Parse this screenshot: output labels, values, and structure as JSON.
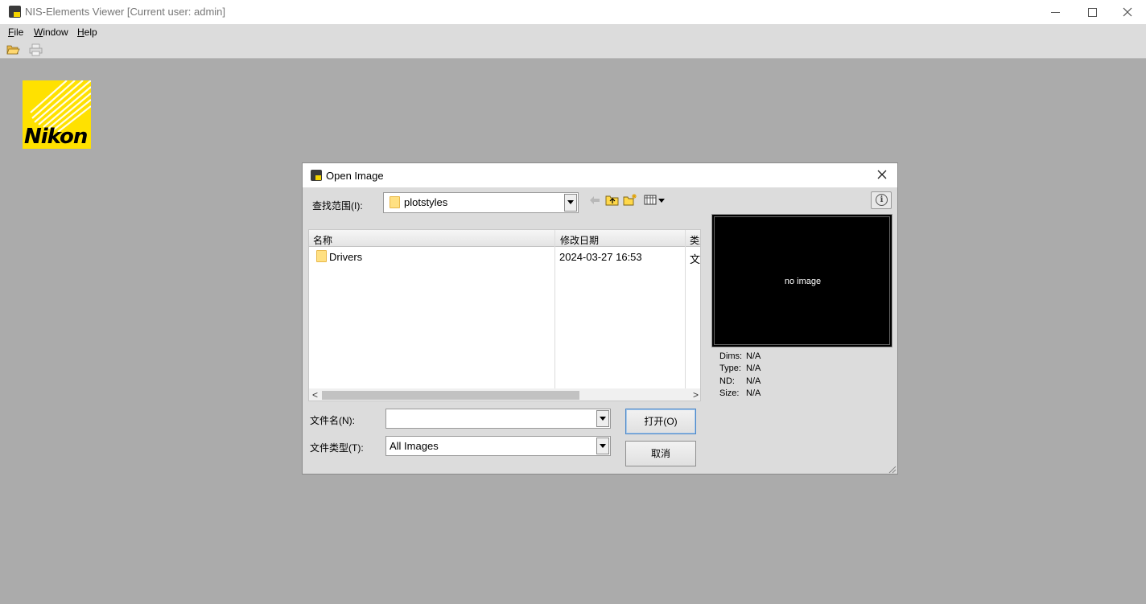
{
  "window": {
    "title": "NIS-Elements Viewer [Current user: admin]"
  },
  "menu": [
    {
      "key": "F",
      "rest": "ile"
    },
    {
      "key": "W",
      "rest": "indow"
    },
    {
      "key": "H",
      "rest": "elp"
    }
  ],
  "toolbar": {
    "icons": [
      "open-folder-icon",
      "print-icon"
    ]
  },
  "logo": {
    "text": "Nikon",
    "color": "#ffe100"
  },
  "dialog": {
    "title": "Open Image",
    "look_in_label": "查找范围(I):",
    "look_in_value": "plotstyles",
    "columns": [
      "名称",
      "修改日期",
      "类型"
    ],
    "files": [
      {
        "name": "Drivers",
        "modified": "2024-03-27 16:53",
        "type": "文件夹"
      }
    ],
    "filename_label": "文件名(N):",
    "filename_value": "",
    "filetype_label": "文件类型(T):",
    "filetype_value": "All Images",
    "open_button": "打开(O)",
    "cancel_button": "取消",
    "preview_text": "no image",
    "meta": [
      {
        "key": "Dims:",
        "value": "N/A"
      },
      {
        "key": "Type:",
        "value": "N/A"
      },
      {
        "key": "ND:",
        "value": "N/A"
      },
      {
        "key": "Size:",
        "value": "N/A"
      }
    ]
  }
}
